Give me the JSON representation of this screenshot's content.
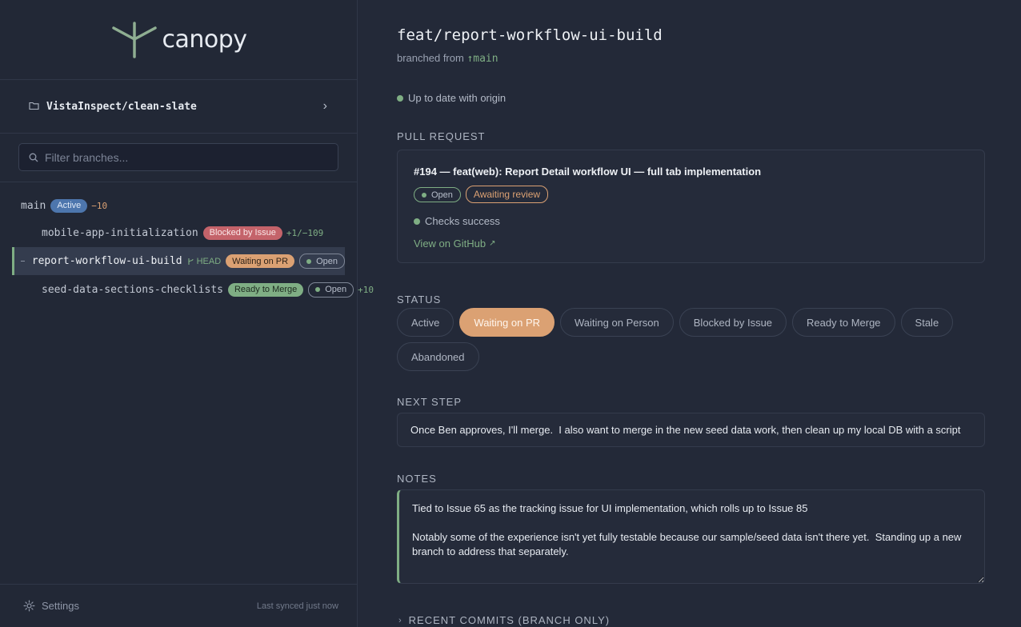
{
  "app": {
    "name": "canopy"
  },
  "repo": {
    "name": "VistaInspect/clean-slate"
  },
  "filter": {
    "placeholder": "Filter branches..."
  },
  "branches": [
    {
      "name": "main",
      "badge": "Active",
      "diff_del": "−10"
    },
    {
      "name": "mobile-app-initialization",
      "badge": "Blocked by Issue",
      "diff_add": "+1",
      "diff_sep": "/",
      "diff_del": "−109"
    },
    {
      "name": "report-workflow-ui-build",
      "head": "HEAD",
      "badge": "Waiting on PR",
      "pr_state": "Open"
    },
    {
      "name": "seed-data-sections-checklists",
      "badge": "Ready to Merge",
      "pr_state": "Open",
      "diff_add": "+10"
    }
  ],
  "footer": {
    "settings_label": "Settings",
    "synced": "Last synced just now"
  },
  "detail": {
    "branch": "feat/report-workflow-ui-build",
    "branched_from_label": "branched from",
    "base_branch": "main",
    "sync_status": "Up to date with origin",
    "pr_section_label": "PULL REQUEST",
    "pr": {
      "title": "#194 — feat(web): Report Detail workflow UI — full tab implementation",
      "state": "Open",
      "review": "Awaiting review",
      "checks": "Checks success",
      "link": "View on GitHub"
    },
    "status_section_label": "STATUS",
    "statuses": [
      "Active",
      "Waiting on PR",
      "Waiting on Person",
      "Blocked by Issue",
      "Ready to Merge",
      "Stale",
      "Abandoned"
    ],
    "selected_status": "Waiting on PR",
    "next_step_label": "NEXT STEP",
    "next_step": "Once Ben approves, I'll merge.  I also want to merge in the new seed data work, then clean up my local DB with a script",
    "notes_label": "NOTES",
    "notes": "Tied to Issue 65 as the tracking issue for UI implementation, which rolls up to Issue 85\n\nNotably some of the experience isn't yet fully testable because our sample/seed data isn't there yet.  Standing up a new branch to address that separately.",
    "recent_commits_label": "RECENT COMMITS (BRANCH ONLY)"
  },
  "colors": {
    "accent_green": "#7fae84",
    "accent_orange": "#dba173",
    "blocked_red": "#c4636a",
    "active_blue": "#4d76ad"
  }
}
